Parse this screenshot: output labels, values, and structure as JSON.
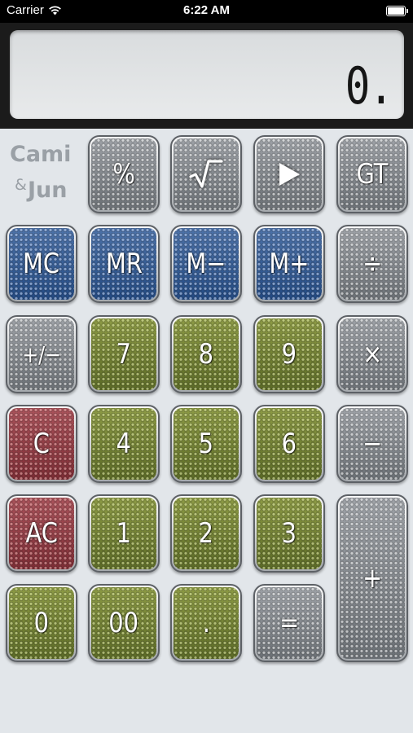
{
  "status_bar": {
    "carrier": "Carrier",
    "time": "6:22 AM",
    "wifi_icon": "wifi-icon",
    "battery_icon": "battery-icon"
  },
  "display": {
    "value": "0."
  },
  "logo": {
    "line1": "Cami",
    "ampersand": "&",
    "line2": "Jun"
  },
  "colors": {
    "gray_key": "#8a8e93",
    "blue_key": "#36598f",
    "green_key": "#76843a",
    "red_key": "#953f47",
    "background": "#e2e6ea"
  },
  "keys": {
    "percent": "%",
    "sqrt_icon": "square-root-icon",
    "play_icon": "play-icon",
    "gt": "GT",
    "mc": "MC",
    "mr": "MR",
    "m_minus": "M−",
    "m_plus": "M+",
    "divide": "÷",
    "plus_minus": "+/−",
    "seven": "7",
    "eight": "8",
    "nine": "9",
    "multiply": "×",
    "clear": "C",
    "four": "4",
    "five": "5",
    "six": "6",
    "minus": "−",
    "all_clear": "AC",
    "one": "1",
    "two": "2",
    "three": "3",
    "plus": "+",
    "zero": "0",
    "double_zero": "00",
    "decimal": ".",
    "equals": "="
  }
}
